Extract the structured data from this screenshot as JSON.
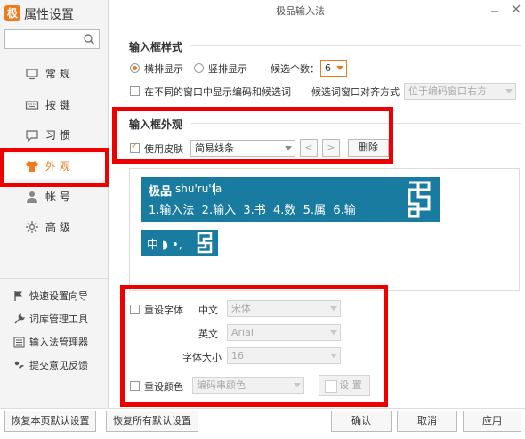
{
  "app": {
    "logo_char": "极",
    "title": "属性设置",
    "window_title": "极品输入法"
  },
  "search": {
    "placeholder": ""
  },
  "nav": [
    {
      "label": "常 规",
      "icon": "monitor-icon"
    },
    {
      "label": "按 键",
      "icon": "keyboard-icon"
    },
    {
      "label": "习 惯",
      "icon": "chat-bubble-icon"
    },
    {
      "label": "外 观",
      "icon": "tshirt-icon"
    },
    {
      "label": "帐 号",
      "icon": "user-icon"
    },
    {
      "label": "高 级",
      "icon": "gear-icon"
    }
  ],
  "nav_active": "外 观",
  "tools": [
    {
      "label": "快速设置向导",
      "icon": "flag-icon"
    },
    {
      "label": "词库管理工具",
      "icon": "wrench-icon"
    },
    {
      "label": "输入法管理器",
      "icon": "list-icon"
    },
    {
      "label": "提交意见反馈",
      "icon": "feedback-icon"
    }
  ],
  "input_style": {
    "title": "输入框样式",
    "horizontal": "横排显示",
    "vertical": "竖排显示",
    "selected": "横排显示",
    "count_label": "候选个数：",
    "count_value": "6",
    "separate_label": "在不同的窗口中显示编码和候选词",
    "separate_checked": false,
    "align_label": "候选词窗口对齐方式",
    "align_value": "位于编码窗口右方"
  },
  "appearance": {
    "title": "输入框外观",
    "skin_label": "使用皮肤",
    "skin_checked": true,
    "skin_value": "简易线条",
    "prev_glyph": "<",
    "next_glyph": ">",
    "delete_label": "删除"
  },
  "preview": {
    "brand": "极品",
    "composition": "shu'ru'fa",
    "candidates": "1.输入法  2.输入  3.书  4.数  5.属  6.输",
    "status_chars": "中 ◗ •,"
  },
  "font": {
    "reset_label": "重设字体",
    "reset_checked": false,
    "chinese_label": "中文",
    "chinese_value": "宋体",
    "english_label": "英文",
    "english_value": "Arial",
    "size_label": "字体大小",
    "size_value": "16",
    "color_label": "重设颜色",
    "color_checked": false,
    "color_target": "编码串颜色",
    "color_button": "设 置"
  },
  "buttons": {
    "restore_page": "恢复本页默认设置",
    "restore_all": "恢复所有默认设置",
    "ok": "确认",
    "cancel": "取消",
    "apply": "应用"
  },
  "colors": {
    "accent": "#f07b1f",
    "highlight": "#e00000",
    "skin": "#1a7ba0"
  }
}
